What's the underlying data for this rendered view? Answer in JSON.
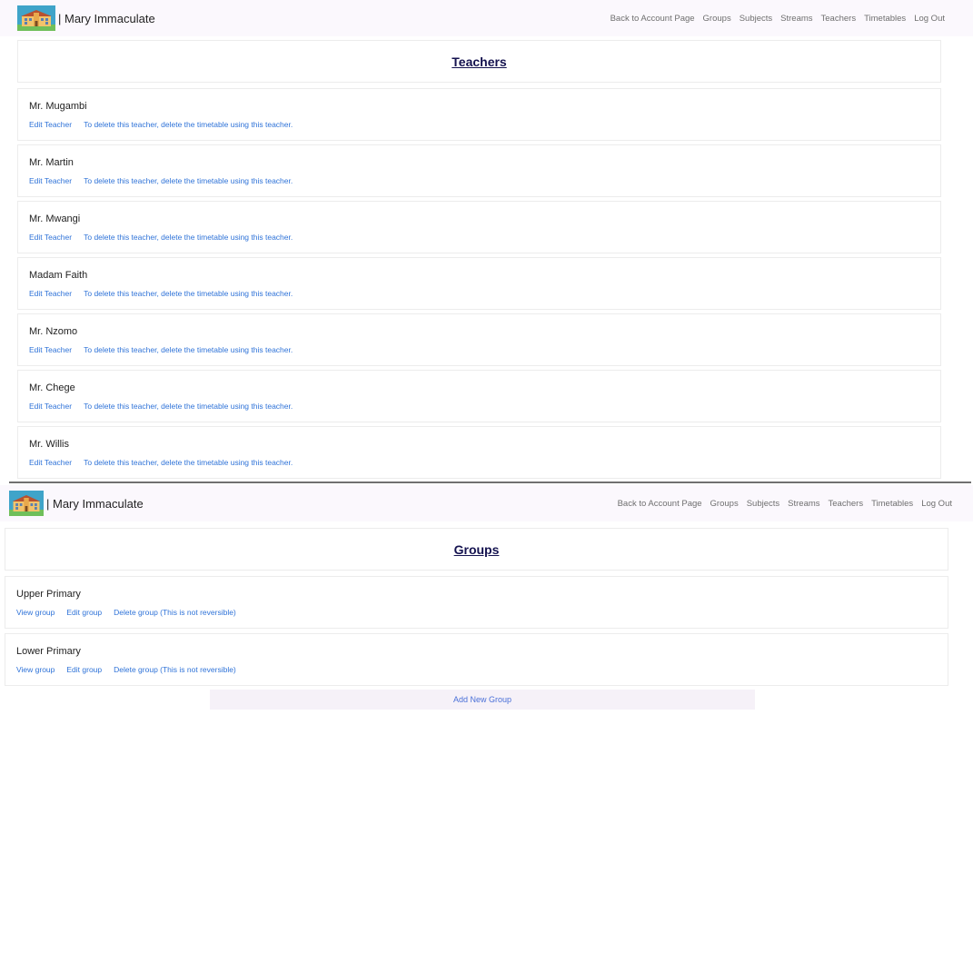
{
  "brand": {
    "label": "| Mary Immaculate"
  },
  "nav": {
    "back": "Back to Account Page",
    "groups": "Groups",
    "subjects": "Subjects",
    "streams": "Streams",
    "teachers": "Teachers",
    "timetables": "Timetables",
    "logout": "Log Out"
  },
  "teachers_page": {
    "title": "Teachers",
    "edit_label": "Edit Teacher",
    "delete_note": "To delete this teacher, delete the timetable using this teacher.",
    "teachers": [
      "Mr. Mugambi",
      "Mr. Martin",
      "Mr. Mwangi",
      "Madam Faith",
      "Mr. Nzomo",
      "Mr. Chege",
      "Mr. Willis"
    ]
  },
  "groups_page": {
    "title": "Groups",
    "view_label": "View group",
    "edit_label": "Edit group",
    "delete_label": "Delete group (This is not reversible)",
    "groups": [
      "Upper Primary",
      "Lower Primary"
    ],
    "add_button": "Add New Group"
  },
  "colors": {
    "link": "#2f73d8",
    "title": "#14124f",
    "navbar_bg": "#fbf8fd"
  },
  "icons": {
    "logo": "school-building-icon"
  }
}
